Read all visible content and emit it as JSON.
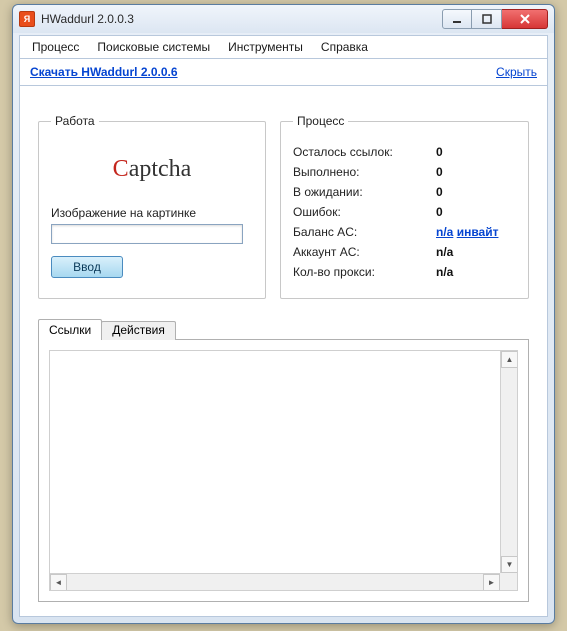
{
  "titlebar": {
    "title": "HWaddurl 2.0.0.3"
  },
  "menu": {
    "process": "Процесс",
    "search": "Поисковые системы",
    "tools": "Инструменты",
    "help": "Справка"
  },
  "linkbar": {
    "download": "Скачать HWaddurl 2.0.0.6",
    "hide": "Скрыть"
  },
  "work": {
    "legend": "Работа",
    "captcha_c": "C",
    "captcha_rest": "aptcha",
    "img_label": "Изображение на картинке",
    "input_value": "",
    "submit": "Ввод"
  },
  "process": {
    "legend": "Процесс",
    "rows": {
      "remaining": {
        "label": "Осталось ссылок:",
        "value": "0"
      },
      "done": {
        "label": "Выполнено:",
        "value": "0"
      },
      "waiting": {
        "label": "В ожидании:",
        "value": "0"
      },
      "errors": {
        "label": "Ошибок:",
        "value": "0"
      },
      "balance": {
        "label": "Баланс AC:",
        "value": "n/a",
        "invite": "инвайт"
      },
      "account": {
        "label": "Аккаунт AC:",
        "value": "n/a"
      },
      "proxies": {
        "label": "Кол-во прокси:",
        "value": "n/a"
      }
    }
  },
  "tabs": {
    "links": "Ссылки",
    "actions": "Действия"
  }
}
